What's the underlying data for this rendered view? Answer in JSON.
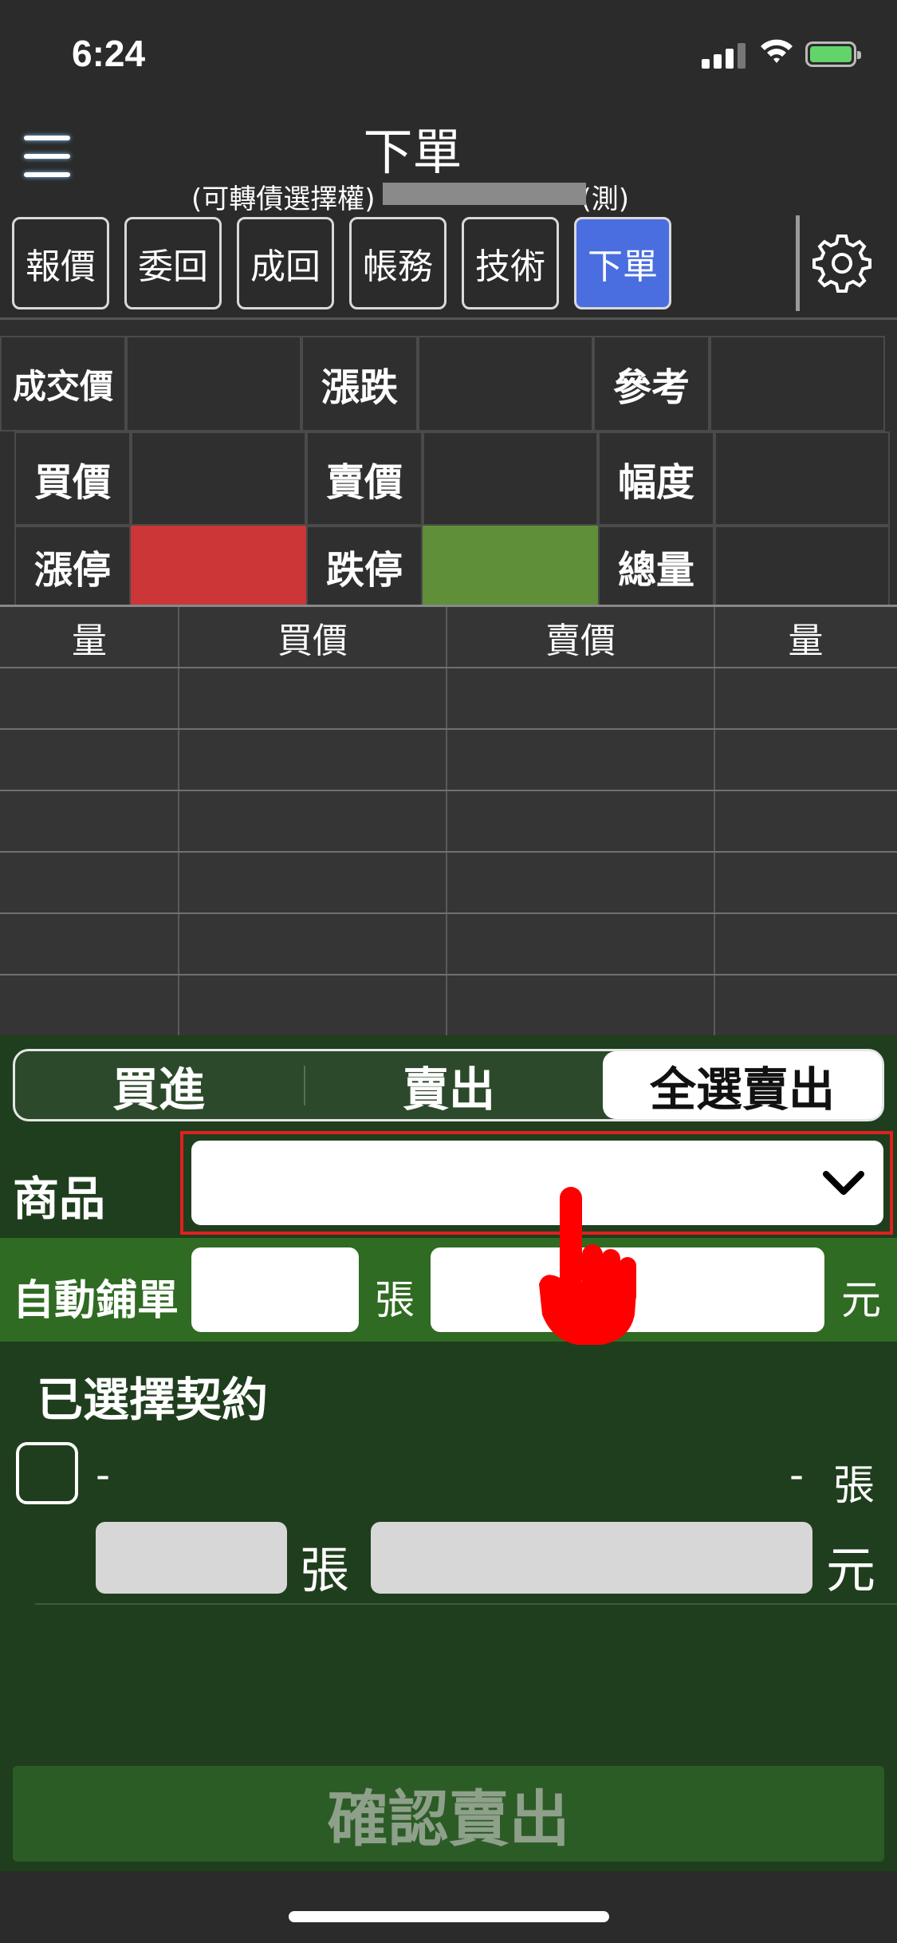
{
  "status_bar": {
    "time": "6:24"
  },
  "header": {
    "title": "下單",
    "subtitle_prefix": "(可轉債選擇權)",
    "subtitle_suffix": "(測)"
  },
  "tabs": [
    {
      "label": "報價",
      "active": false
    },
    {
      "label": "委回",
      "active": false
    },
    {
      "label": "成回",
      "active": false
    },
    {
      "label": "帳務",
      "active": false
    },
    {
      "label": "技術",
      "active": false
    },
    {
      "label": "下單",
      "active": true
    }
  ],
  "quote": {
    "rows": [
      [
        "成交價",
        "",
        "漲跌",
        "",
        "參考",
        ""
      ],
      [
        "買價",
        "",
        "賣價",
        "",
        "幅度",
        ""
      ],
      [
        "漲停",
        "",
        "跌停",
        "",
        "總量",
        ""
      ]
    ],
    "limit_up_color": "#cc3636",
    "limit_down_color": "#5f8f38"
  },
  "order_book": {
    "headers": [
      "量",
      "買價",
      "賣價",
      "量"
    ],
    "row_count": 6
  },
  "trade_mode": {
    "options": [
      "買進",
      "賣出",
      "全選賣出"
    ],
    "selected": "全選賣出"
  },
  "product": {
    "label": "商品",
    "value": ""
  },
  "auto_order": {
    "label": "自動鋪單",
    "lots_unit": "張",
    "price_unit": "元"
  },
  "selected_contracts": {
    "title": "已選擇契約",
    "items": [
      {
        "name": "-",
        "qty_dash": "-",
        "qty_unit": "張",
        "lots_unit": "張",
        "price_unit": "元"
      }
    ]
  },
  "confirm_button": {
    "label": "確認賣出"
  },
  "colors": {
    "accent_tab": "#4a6ee0",
    "panel_bg": "#1f3e1d",
    "auto_bar_bg": "#2f6b22",
    "highlight_box": "#e02020"
  }
}
